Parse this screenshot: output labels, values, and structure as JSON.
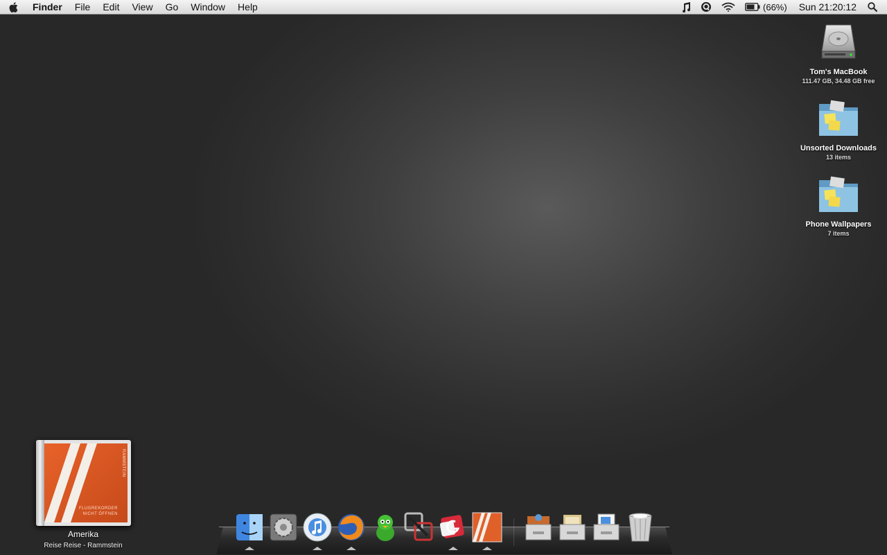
{
  "menubar": {
    "app_name": "Finder",
    "menus": [
      "File",
      "Edit",
      "View",
      "Go",
      "Window",
      "Help"
    ],
    "battery_text": "(66%)",
    "clock": "Sun 21:20:12"
  },
  "desktop_icons": [
    {
      "label": "Tom's MacBook",
      "sub": "111.47 GB, 34.48 GB free",
      "icon": "hard-drive-icon"
    },
    {
      "label": "Unsorted Downloads",
      "sub": "13 items",
      "icon": "folder-icon"
    },
    {
      "label": "Phone Wallpapers",
      "sub": "7 items",
      "icon": "folder-icon"
    }
  ],
  "now_playing": {
    "title": "Amerika",
    "subtitle": "Reise Reise - Rammstein",
    "cover_text_line1": "FLUGREKORDER",
    "cover_text_line2": "NICHT ÖFFNEN",
    "cover_band": "RAMMSTEIN"
  },
  "dock": {
    "apps": [
      {
        "name": "Finder",
        "icon": "finder-icon",
        "running": true
      },
      {
        "name": "System Preferences",
        "icon": "system-preferences-icon",
        "running": false
      },
      {
        "name": "iTunes",
        "icon": "itunes-icon",
        "running": true
      },
      {
        "name": "Firefox",
        "icon": "firefox-icon",
        "running": true
      },
      {
        "name": "Adium",
        "icon": "adium-icon",
        "running": false
      },
      {
        "name": "VMware Fusion",
        "icon": "vmware-icon",
        "running": false
      },
      {
        "name": "Growl",
        "icon": "growl-icon",
        "running": true
      },
      {
        "name": "Album Art",
        "icon": "album-art-icon",
        "running": true
      }
    ],
    "stacks": [
      {
        "name": "Applications",
        "icon": "applications-stack-icon"
      },
      {
        "name": "Documents",
        "icon": "documents-stack-icon"
      },
      {
        "name": "Downloads",
        "icon": "downloads-stack-icon"
      },
      {
        "name": "Trash",
        "icon": "trash-icon"
      }
    ]
  },
  "colors": {
    "menubar_bg": "#e6e6e6",
    "desktop_bg": "#3a3a3a",
    "album_orange": "#e0602a",
    "folder_blue": "#7fb6d8"
  }
}
